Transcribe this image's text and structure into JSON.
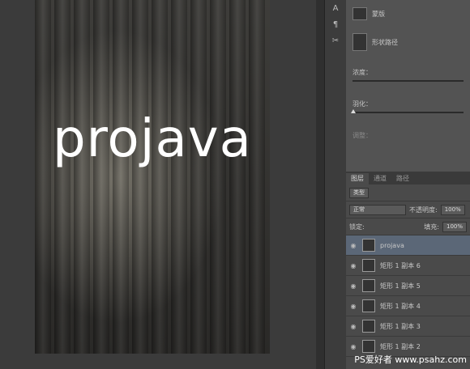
{
  "canvas": {
    "logo_text": "projava"
  },
  "toolstrip": {
    "items": [
      "A",
      "¶",
      "✂"
    ]
  },
  "properties": {
    "masks": [
      {
        "label": "蒙版",
        "icon": "mask-icon"
      },
      {
        "label": "形状路径",
        "icon": "vector-mask-icon"
      }
    ],
    "density_label": "浓度：",
    "feather_label": "羽化：",
    "adjust_label": "调整："
  },
  "layers_panel": {
    "tabs": [
      "图层",
      "通道",
      "路径"
    ],
    "filter_label": "类型",
    "blend_mode": "正常",
    "opacity_label": "不透明度:",
    "opacity_value": "100%",
    "lock_label": "锁定:",
    "fill_label": "填充:",
    "fill_value": "100%",
    "layers": [
      {
        "name": "projava",
        "selected": true
      },
      {
        "name": "矩形 1 副本 6",
        "selected": false
      },
      {
        "name": "矩形 1 副本 5",
        "selected": false
      },
      {
        "name": "矩形 1 副本 4",
        "selected": false
      },
      {
        "name": "矩形 1 副本 3",
        "selected": false
      },
      {
        "name": "矩形 1 副本 2",
        "selected": false
      }
    ]
  },
  "watermark": {
    "text": "PS爱好者 www.psahz.com"
  }
}
